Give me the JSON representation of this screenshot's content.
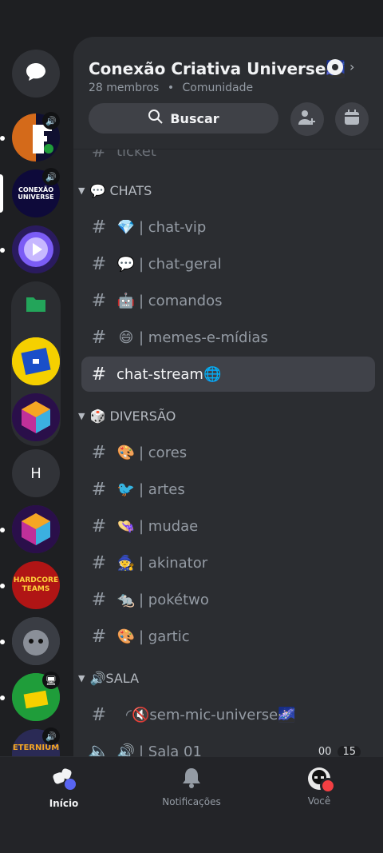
{
  "server": {
    "name": "Conexão Criativa Universe🌌",
    "members": "28 membros",
    "separator": "•",
    "type": "Comunidade",
    "search_label": "Buscar"
  },
  "rail": {
    "server_badge_text": "CONEXÃO UNIVERSE",
    "letter_server": "H",
    "bottom_server_text": "ETERNIUM",
    "hardcore_text": "HARDCORE TEAMS"
  },
  "channels": {
    "partial_top": "ticket",
    "categories": [
      {
        "label": "💬 CHATS"
      },
      {
        "label": "🎲 DIVERSÃO"
      },
      {
        "label": "🔊SALA"
      }
    ],
    "chats": [
      {
        "emoji": "💎",
        "name": "| chat-vip"
      },
      {
        "emoji": "💬",
        "name": "| chat-geral"
      },
      {
        "emoji": "🤖",
        "name": "| comandos"
      },
      {
        "emoji": "😄",
        "name": "| memes-e-mídias"
      },
      {
        "emoji": "",
        "name": "chat-stream🌐"
      }
    ],
    "diversao": [
      {
        "emoji": "🎨",
        "name": "| cores"
      },
      {
        "emoji": "🐦",
        "name": "| artes"
      },
      {
        "emoji": "👒",
        "name": "| mudae"
      },
      {
        "emoji": "🧙",
        "name": "| akinator"
      },
      {
        "emoji": "🐀",
        "name": "| pokétwo"
      },
      {
        "emoji": "🎨",
        "name": "| gartic"
      }
    ],
    "sala": [
      {
        "emoji": "",
        "name": "◜🔇sem-mic-universe🌌"
      },
      {
        "emoji": "🔊",
        "name": "| Sala 01",
        "time": "00",
        "count": "15"
      }
    ]
  },
  "tabs": [
    {
      "label": "Início"
    },
    {
      "label": "Notificações"
    },
    {
      "label": "Você"
    }
  ],
  "colors": {
    "accent": "#5865f2",
    "background": "#1e1f22",
    "panel": "#2b2d31",
    "status_dnd": "#f23f43"
  }
}
